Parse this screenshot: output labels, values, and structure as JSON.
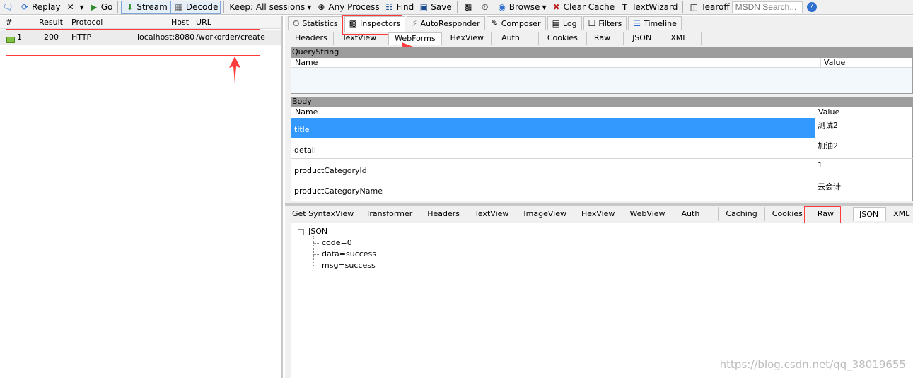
{
  "toolbar": {
    "replay": "Replay",
    "go": "Go",
    "stream": "Stream",
    "decode": "Decode",
    "keep": "Keep: All sessions",
    "any_process": "Any Process",
    "find": "Find",
    "save": "Save",
    "browse": "Browse",
    "clear_cache": "Clear Cache",
    "textwizard": "TextWizard",
    "tearoff": "Tearoff",
    "msdn_placeholder": "MSDN Search..."
  },
  "sessions": {
    "headers": {
      "num": "#",
      "result": "Result",
      "protocol": "Protocol",
      "host": "Host",
      "url": "URL"
    },
    "rows": [
      {
        "num": "1",
        "result": "200",
        "protocol": "HTTP",
        "host": "localhost:8080",
        "url": "/workorder/create"
      }
    ]
  },
  "main_tabs": {
    "statistics": "Statistics",
    "inspectors": "Inspectors",
    "autoresponder": "AutoResponder",
    "composer": "Composer",
    "log": "Log",
    "filters": "Filters",
    "timeline": "Timeline"
  },
  "request_tabs": [
    "Headers",
    "TextView",
    "WebForms",
    "HexView",
    "Auth",
    "Cookies",
    "Raw",
    "JSON",
    "XML"
  ],
  "querystring": {
    "title": "QueryString",
    "name_col": "Name",
    "value_col": "Value"
  },
  "body": {
    "title": "Body",
    "name_col": "Name",
    "value_col": "Value",
    "rows": [
      {
        "name": "title",
        "value": "测试2"
      },
      {
        "name": "detail",
        "value": "加油2"
      },
      {
        "name": "productCategoryId",
        "value": "1"
      },
      {
        "name": "productCategoryName",
        "value": "云会计"
      }
    ]
  },
  "response_tabs": [
    "Get SyntaxView",
    "Transformer",
    "Headers",
    "TextView",
    "ImageView",
    "HexView",
    "WebView",
    "Auth",
    "Caching",
    "Cookies",
    "Raw",
    "JSON",
    "XML"
  ],
  "json_tree": {
    "root": "JSON",
    "children": [
      "code=0",
      "data=success",
      "msg=success"
    ]
  },
  "watermark": "https://blog.csdn.net/qq_38019655",
  "colors": {
    "selection": "#3399ff",
    "annotation": "#ff3b3b"
  }
}
